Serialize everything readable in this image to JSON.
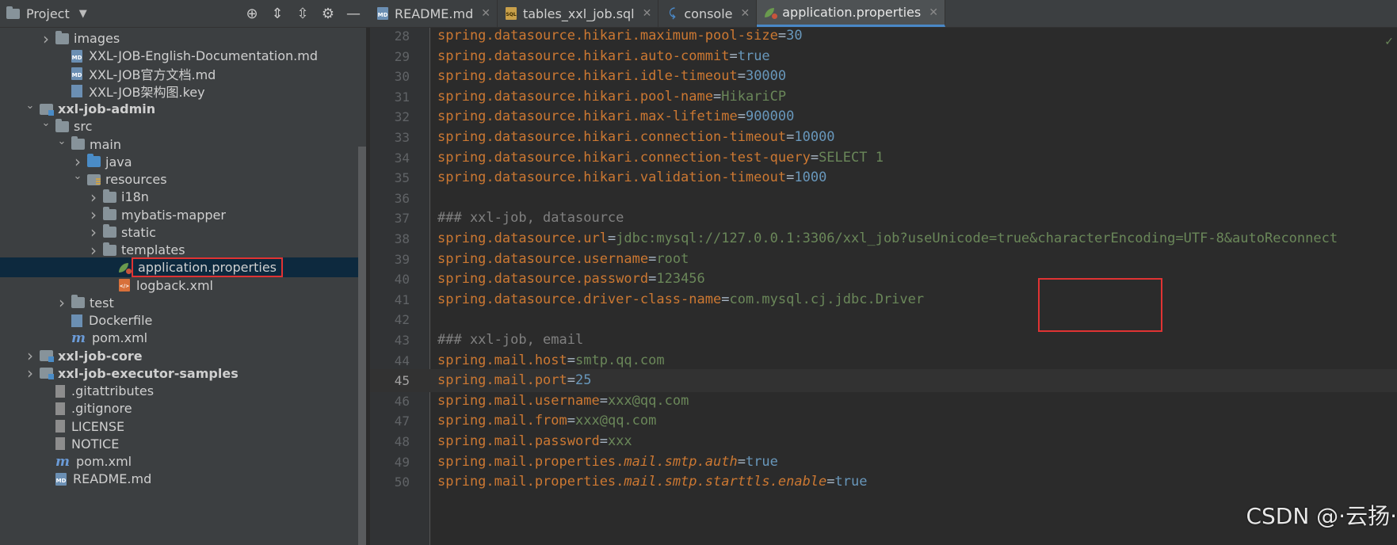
{
  "project_panel": {
    "title": "Project",
    "header_icons": [
      "locate-icon",
      "expand-all-icon",
      "collapse-all-icon",
      "gear-icon",
      "minimize-icon"
    ]
  },
  "tabs": [
    {
      "label": "README.md",
      "icon": "markdown-file-icon",
      "active": false
    },
    {
      "label": "tables_xxl_job.sql",
      "icon": "sql-file-icon",
      "active": false
    },
    {
      "label": "console",
      "icon": "console-icon",
      "active": false
    },
    {
      "label": "application.properties",
      "icon": "properties-file-icon",
      "active": true
    }
  ],
  "tree": [
    {
      "label": "images",
      "indent": 1,
      "chevron": ">",
      "icon": "folder",
      "bold": false
    },
    {
      "label": "XXL-JOB-English-Documentation.md",
      "indent": 2,
      "chevron": "",
      "icon": "md",
      "bold": false
    },
    {
      "label": "XXL-JOB官方文档.md",
      "indent": 2,
      "chevron": "",
      "icon": "md",
      "bold": false
    },
    {
      "label": "XXL-JOB架构图.key",
      "indent": 2,
      "chevron": "",
      "icon": "key",
      "bold": false
    },
    {
      "label": "xxl-job-admin",
      "indent": 0,
      "chevron": "v",
      "icon": "module",
      "bold": true
    },
    {
      "label": "src",
      "indent": 1,
      "chevron": "v",
      "icon": "folder",
      "bold": false
    },
    {
      "label": "main",
      "indent": 2,
      "chevron": "v",
      "icon": "folder",
      "bold": false
    },
    {
      "label": "java",
      "indent": 3,
      "chevron": ">",
      "icon": "folder-blue",
      "bold": false
    },
    {
      "label": "resources",
      "indent": 3,
      "chevron": "v",
      "icon": "res",
      "bold": false
    },
    {
      "label": "i18n",
      "indent": 4,
      "chevron": ">",
      "icon": "folder",
      "bold": false
    },
    {
      "label": "mybatis-mapper",
      "indent": 4,
      "chevron": ">",
      "icon": "folder",
      "bold": false
    },
    {
      "label": "static",
      "indent": 4,
      "chevron": ">",
      "icon": "folder",
      "bold": false
    },
    {
      "label": "templates",
      "indent": 4,
      "chevron": ">",
      "icon": "folder",
      "bold": false
    },
    {
      "label": "application.properties",
      "indent": 5,
      "chevron": "",
      "icon": "props",
      "bold": false,
      "selected": true
    },
    {
      "label": "logback.xml",
      "indent": 5,
      "chevron": "",
      "icon": "xml",
      "bold": false
    },
    {
      "label": "test",
      "indent": 2,
      "chevron": ">",
      "icon": "folder",
      "bold": false
    },
    {
      "label": "Dockerfile",
      "indent": 2,
      "chevron": "",
      "icon": "docker",
      "bold": false
    },
    {
      "label": "pom.xml",
      "indent": 2,
      "chevron": "",
      "icon": "mvn",
      "bold": false
    },
    {
      "label": "xxl-job-core",
      "indent": 0,
      "chevron": ">",
      "icon": "module",
      "bold": true
    },
    {
      "label": "xxl-job-executor-samples",
      "indent": 0,
      "chevron": ">",
      "icon": "module",
      "bold": true
    },
    {
      "label": ".gitattributes",
      "indent": 1,
      "chevron": "",
      "icon": "text",
      "bold": false
    },
    {
      "label": ".gitignore",
      "indent": 1,
      "chevron": "",
      "icon": "text",
      "bold": false
    },
    {
      "label": "LICENSE",
      "indent": 1,
      "chevron": "",
      "icon": "text",
      "bold": false
    },
    {
      "label": "NOTICE",
      "indent": 1,
      "chevron": "",
      "icon": "text",
      "bold": false
    },
    {
      "label": "pom.xml",
      "indent": 1,
      "chevron": "",
      "icon": "mvn",
      "bold": false
    },
    {
      "label": "README.md",
      "indent": 1,
      "chevron": "",
      "icon": "md",
      "bold": false
    }
  ],
  "editor": {
    "current_line": 45,
    "lines": [
      {
        "n": "28",
        "parts": [
          [
            "k",
            "spring.datasource.hikari.maximum-pool-size"
          ],
          [
            "eq",
            "="
          ],
          [
            "num",
            "30"
          ]
        ]
      },
      {
        "n": "29",
        "parts": [
          [
            "k",
            "spring.datasource.hikari.auto-commit"
          ],
          [
            "eq",
            "="
          ],
          [
            "num",
            "true"
          ]
        ]
      },
      {
        "n": "30",
        "parts": [
          [
            "k",
            "spring.datasource.hikari.idle-timeout"
          ],
          [
            "eq",
            "="
          ],
          [
            "num",
            "30000"
          ]
        ]
      },
      {
        "n": "31",
        "parts": [
          [
            "k",
            "spring.datasource.hikari.pool-name"
          ],
          [
            "eq",
            "="
          ],
          [
            "v",
            "HikariCP"
          ]
        ]
      },
      {
        "n": "32",
        "parts": [
          [
            "k",
            "spring.datasource.hikari.max-lifetime"
          ],
          [
            "eq",
            "="
          ],
          [
            "num",
            "900000"
          ]
        ]
      },
      {
        "n": "33",
        "parts": [
          [
            "k",
            "spring.datasource.hikari.connection-timeout"
          ],
          [
            "eq",
            "="
          ],
          [
            "num",
            "10000"
          ]
        ]
      },
      {
        "n": "34",
        "parts": [
          [
            "k",
            "spring.datasource.hikari.connection-test-query"
          ],
          [
            "eq",
            "="
          ],
          [
            "v",
            "SELECT 1"
          ]
        ]
      },
      {
        "n": "35",
        "parts": [
          [
            "k",
            "spring.datasource.hikari.validation-timeout"
          ],
          [
            "eq",
            "="
          ],
          [
            "num",
            "1000"
          ]
        ]
      },
      {
        "n": "36",
        "parts": []
      },
      {
        "n": "37",
        "parts": [
          [
            "c",
            "### xxl-job, datasource"
          ]
        ]
      },
      {
        "n": "38",
        "parts": [
          [
            "k",
            "spring.datasource.url"
          ],
          [
            "eq",
            "="
          ],
          [
            "v",
            "jdbc:mysql://127.0.0.1:3306/xxl_job?useUnicode=true&characterEncoding=UTF-8&autoReconnect"
          ]
        ]
      },
      {
        "n": "39",
        "parts": [
          [
            "k",
            "spring.datasource.username"
          ],
          [
            "eq",
            "="
          ],
          [
            "v",
            "root"
          ]
        ]
      },
      {
        "n": "40",
        "parts": [
          [
            "k",
            "spring.datasource.password"
          ],
          [
            "eq",
            "="
          ],
          [
            "v",
            "123456"
          ]
        ]
      },
      {
        "n": "41",
        "parts": [
          [
            "k",
            "spring.datasource.driver-class-name"
          ],
          [
            "eq",
            "="
          ],
          [
            "v",
            "com.mysql.cj.jdbc.Driver"
          ]
        ]
      },
      {
        "n": "42",
        "parts": []
      },
      {
        "n": "43",
        "parts": [
          [
            "c",
            "### xxl-job, email"
          ]
        ]
      },
      {
        "n": "44",
        "parts": [
          [
            "k",
            "spring.mail.host"
          ],
          [
            "eq",
            "="
          ],
          [
            "v",
            "smtp.qq.com"
          ]
        ]
      },
      {
        "n": "45",
        "parts": [
          [
            "k",
            "spring.mail.port"
          ],
          [
            "eq",
            "="
          ],
          [
            "num",
            "25"
          ]
        ]
      },
      {
        "n": "46",
        "parts": [
          [
            "k",
            "spring.mail.username"
          ],
          [
            "eq",
            "="
          ],
          [
            "v",
            "xxx@qq.com"
          ]
        ]
      },
      {
        "n": "47",
        "parts": [
          [
            "k",
            "spring.mail.from"
          ],
          [
            "eq",
            "="
          ],
          [
            "v",
            "xxx@qq.com"
          ]
        ]
      },
      {
        "n": "48",
        "parts": [
          [
            "k",
            "spring.mail.password"
          ],
          [
            "eq",
            "="
          ],
          [
            "v",
            "xxx"
          ]
        ]
      },
      {
        "n": "49",
        "parts": [
          [
            "k",
            "spring.mail.properties."
          ],
          [
            "key-it",
            "mail.smtp.auth"
          ],
          [
            "eq",
            "="
          ],
          [
            "num",
            "true"
          ]
        ]
      },
      {
        "n": "50",
        "parts": [
          [
            "k",
            "spring.mail.properties."
          ],
          [
            "key-it",
            "mail.smtp.starttls.enable"
          ],
          [
            "eq",
            "="
          ],
          [
            "num",
            "true"
          ]
        ]
      }
    ]
  },
  "watermark": "CSDN @·云扬·"
}
